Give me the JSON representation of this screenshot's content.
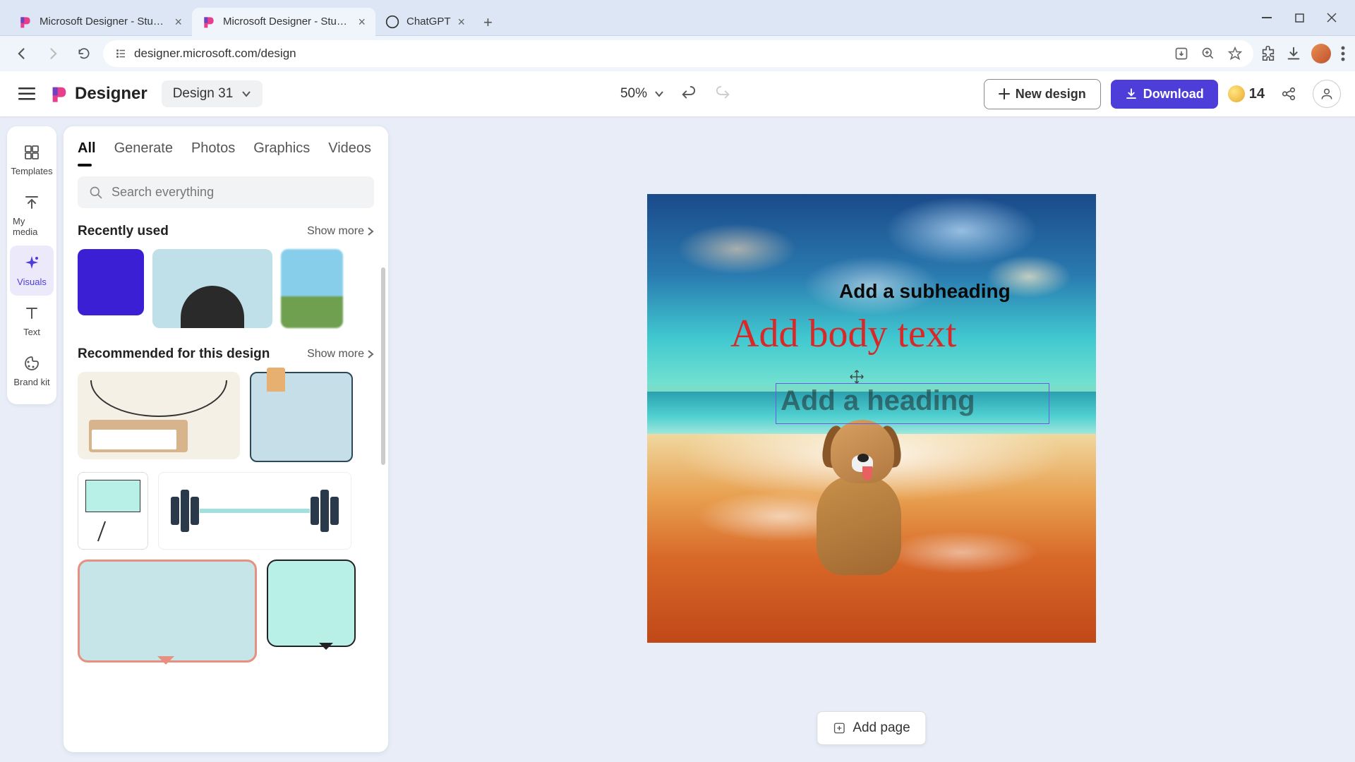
{
  "browser": {
    "tabs": [
      {
        "title": "Microsoft Designer - Stunning"
      },
      {
        "title": "Microsoft Designer - Stunning"
      },
      {
        "title": "ChatGPT"
      }
    ],
    "url": "designer.microsoft.com/design"
  },
  "header": {
    "brand": "Designer",
    "design_name": "Design 31",
    "zoom": "50%",
    "new_design": "New design",
    "download": "Download",
    "credits": "14"
  },
  "rail": {
    "templates": "Templates",
    "my_media": "My media",
    "visuals": "Visuals",
    "text": "Text",
    "brand_kit": "Brand kit"
  },
  "panel": {
    "tabs": {
      "all": "All",
      "generate": "Generate",
      "photos": "Photos",
      "graphics": "Graphics",
      "videos": "Videos"
    },
    "search_placeholder": "Search everything",
    "recently_used": "Recently used",
    "recommended": "Recommended for this design",
    "show_more": "Show more"
  },
  "canvas": {
    "subheading": "Add a subheading",
    "body": "Add body text",
    "heading": "Add a heading"
  },
  "footer": {
    "add_page": "Add page"
  }
}
